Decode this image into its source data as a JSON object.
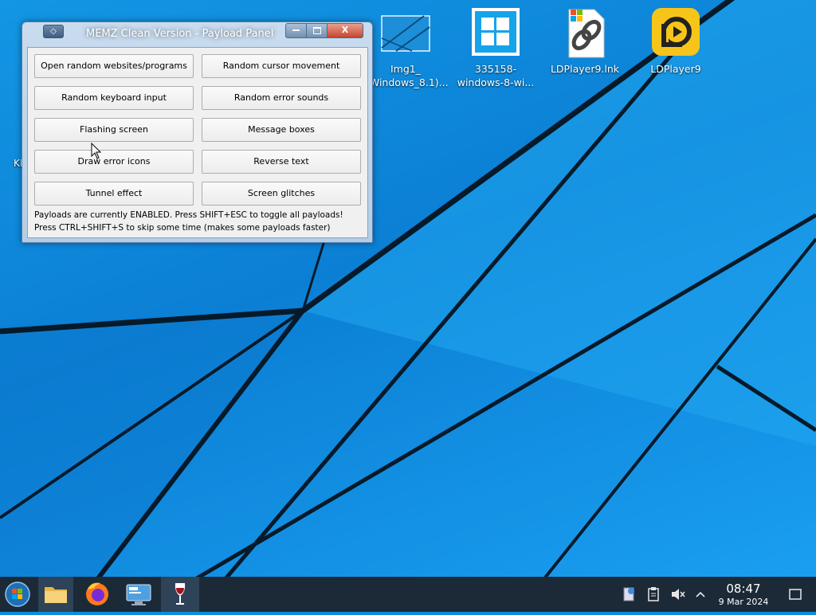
{
  "desktop": {
    "icons": [
      {
        "label_line1": "Img1_",
        "label_line2": "(Windows_8.1)...",
        "icon": "image-file-icon"
      },
      {
        "label_line1": "335158-",
        "label_line2": "windows-8-wi...",
        "icon": "windows-logo-file-icon"
      },
      {
        "label_line1": "LDPlayer9.lnk",
        "label_line2": "",
        "icon": "shortcut-link-icon"
      },
      {
        "label_line1": "LDPlayer9",
        "label_line2": "",
        "icon": "ldplayer-icon"
      }
    ],
    "partial_label": "KE"
  },
  "window": {
    "title": "MEMZ Clean Version - Payload Panel",
    "system_button_glyph": "◇",
    "close_glyph": "X",
    "buttons": [
      "Open random websites/programs",
      "Random cursor movement",
      "Random keyboard input",
      "Random error sounds",
      "Flashing screen",
      "Message boxes",
      "Draw error icons",
      "Reverse text",
      "Tunnel effect",
      "Screen glitches"
    ],
    "note1": "Payloads are currently ENABLED. Press SHIFT+ESC to toggle all payloads!",
    "note2": "Press CTRL+SHIFT+S to skip some time (makes some payloads faster)"
  },
  "taskbar": {
    "pinned": [
      "start-orb-icon",
      "file-manager-icon",
      "firefox-icon",
      "system-settings-icon",
      "wine-glass-icon"
    ],
    "active_item": "wine-glass-icon",
    "tray": [
      "updates-icon",
      "clipboard-icon",
      "volume-muted-icon",
      "chevron-up-icon"
    ],
    "clock": {
      "time": "08:47",
      "date": "9 Mar 2024"
    }
  },
  "colors": {
    "desktop_blue": "#0b7fd4",
    "taskbar": "#1c2a38",
    "ldplayer_yellow": "#f7c51a"
  }
}
